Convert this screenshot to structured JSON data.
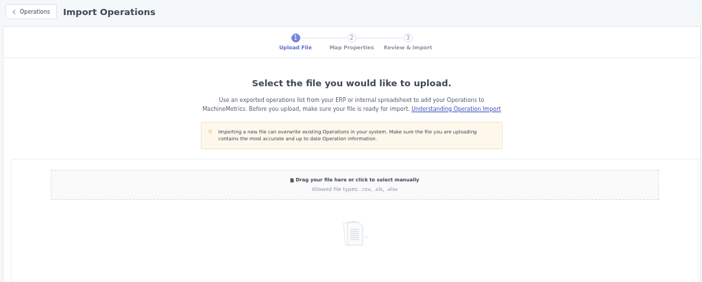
{
  "header": {
    "back_button": "Operations",
    "title": "Import Operations"
  },
  "steps": [
    {
      "number": "1",
      "label": "Upload File",
      "selected": true
    },
    {
      "number": "2",
      "label": "Map Properties",
      "selected": false
    },
    {
      "number": "3",
      "label": "Review & Import",
      "selected": false
    }
  ],
  "heading": "Select the file you would like to upload.",
  "description": {
    "text": "Use an exported operations list from your ERP or internal spreadsheet to add your Operations to MachineMetrics. Before you upload, make sure your file is ready for import.",
    "link": "Understanding Operation Import"
  },
  "warning": "Importing a new file can overwrite existing Operations in your system. Make sure the file you are uploading contains the most accurate and up to date Operation information.",
  "dropzone": {
    "prompt": "Drag your file here or click to select manually",
    "allowed": "Allowed file types: .csv, .xls, .xlsx"
  }
}
